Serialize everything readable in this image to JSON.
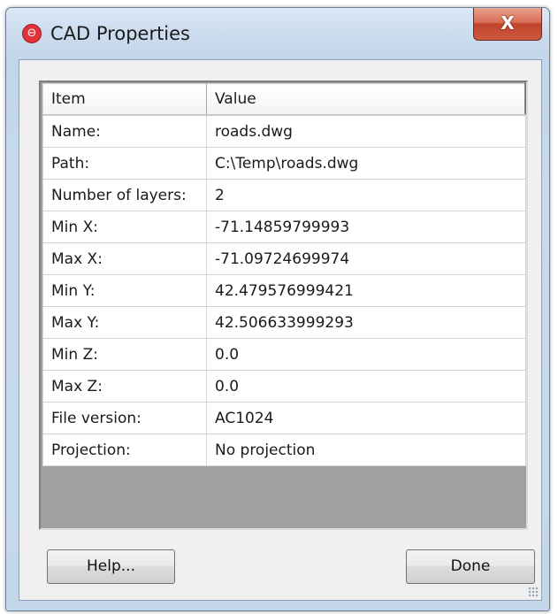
{
  "window": {
    "title": "CAD Properties",
    "close_label": "X",
    "app_icon_glyph": "⊖"
  },
  "table": {
    "headers": [
      "Item",
      "Value"
    ],
    "rows": [
      [
        "Name:",
        "roads.dwg"
      ],
      [
        "Path:",
        "C:\\Temp\\roads.dwg"
      ],
      [
        "Number of layers:",
        "2"
      ],
      [
        "Min X:",
        "-71.14859799993"
      ],
      [
        "Max X:",
        "-71.09724699974"
      ],
      [
        "Min Y:",
        "42.479576999421"
      ],
      [
        "Max Y:",
        "42.506633999293"
      ],
      [
        "Min Z:",
        "0.0"
      ],
      [
        "Max Z:",
        "0.0"
      ],
      [
        "File version:",
        "AC1024"
      ],
      [
        "Projection:",
        "No projection"
      ]
    ]
  },
  "buttons": {
    "help_label": "Help...",
    "done_label": "Done"
  },
  "colors": {
    "close_button": "#c94a32",
    "empty_table_area": "#a0a0a0",
    "app_icon": "#e0323a"
  }
}
